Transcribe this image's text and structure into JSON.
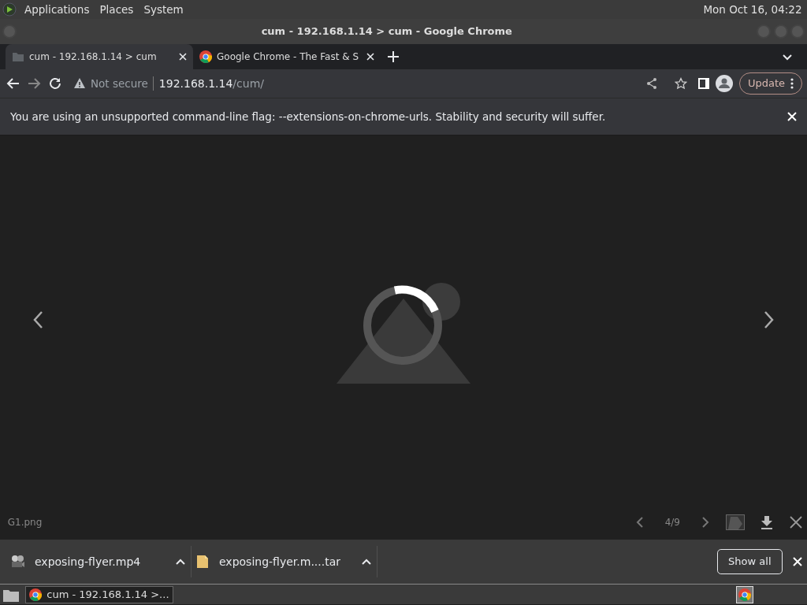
{
  "top_panel": {
    "menus": [
      "Applications",
      "Places",
      "System"
    ],
    "clock": "Mon Oct 16, 04:22"
  },
  "window": {
    "title": "cum - 192.168.1.14 > cum - Google Chrome"
  },
  "tabs": [
    {
      "title": "cum - 192.168.1.14 > cum",
      "kind": "folder",
      "selected": true
    },
    {
      "title": "Google Chrome - The Fast & S",
      "kind": "chrome",
      "selected": false
    }
  ],
  "toolbar": {
    "security": "Not secure",
    "url": {
      "host": "192.168.1.14",
      "path": "/cum/"
    },
    "update": "Update"
  },
  "infobar": {
    "message": "You are using an unsupported command-line flag: --extensions-on-chrome-urls. Stability and security will suffer."
  },
  "viewer": {
    "filename": "G1.png",
    "counter": "4/9"
  },
  "downloads": [
    {
      "name": "exposing-flyer.mp4",
      "kind": "video"
    },
    {
      "name": "exposing-flyer.m....tar",
      "kind": "archive"
    }
  ],
  "show_all": "Show all",
  "taskbar": {
    "window": "cum - 192.168.1.14 >..."
  }
}
